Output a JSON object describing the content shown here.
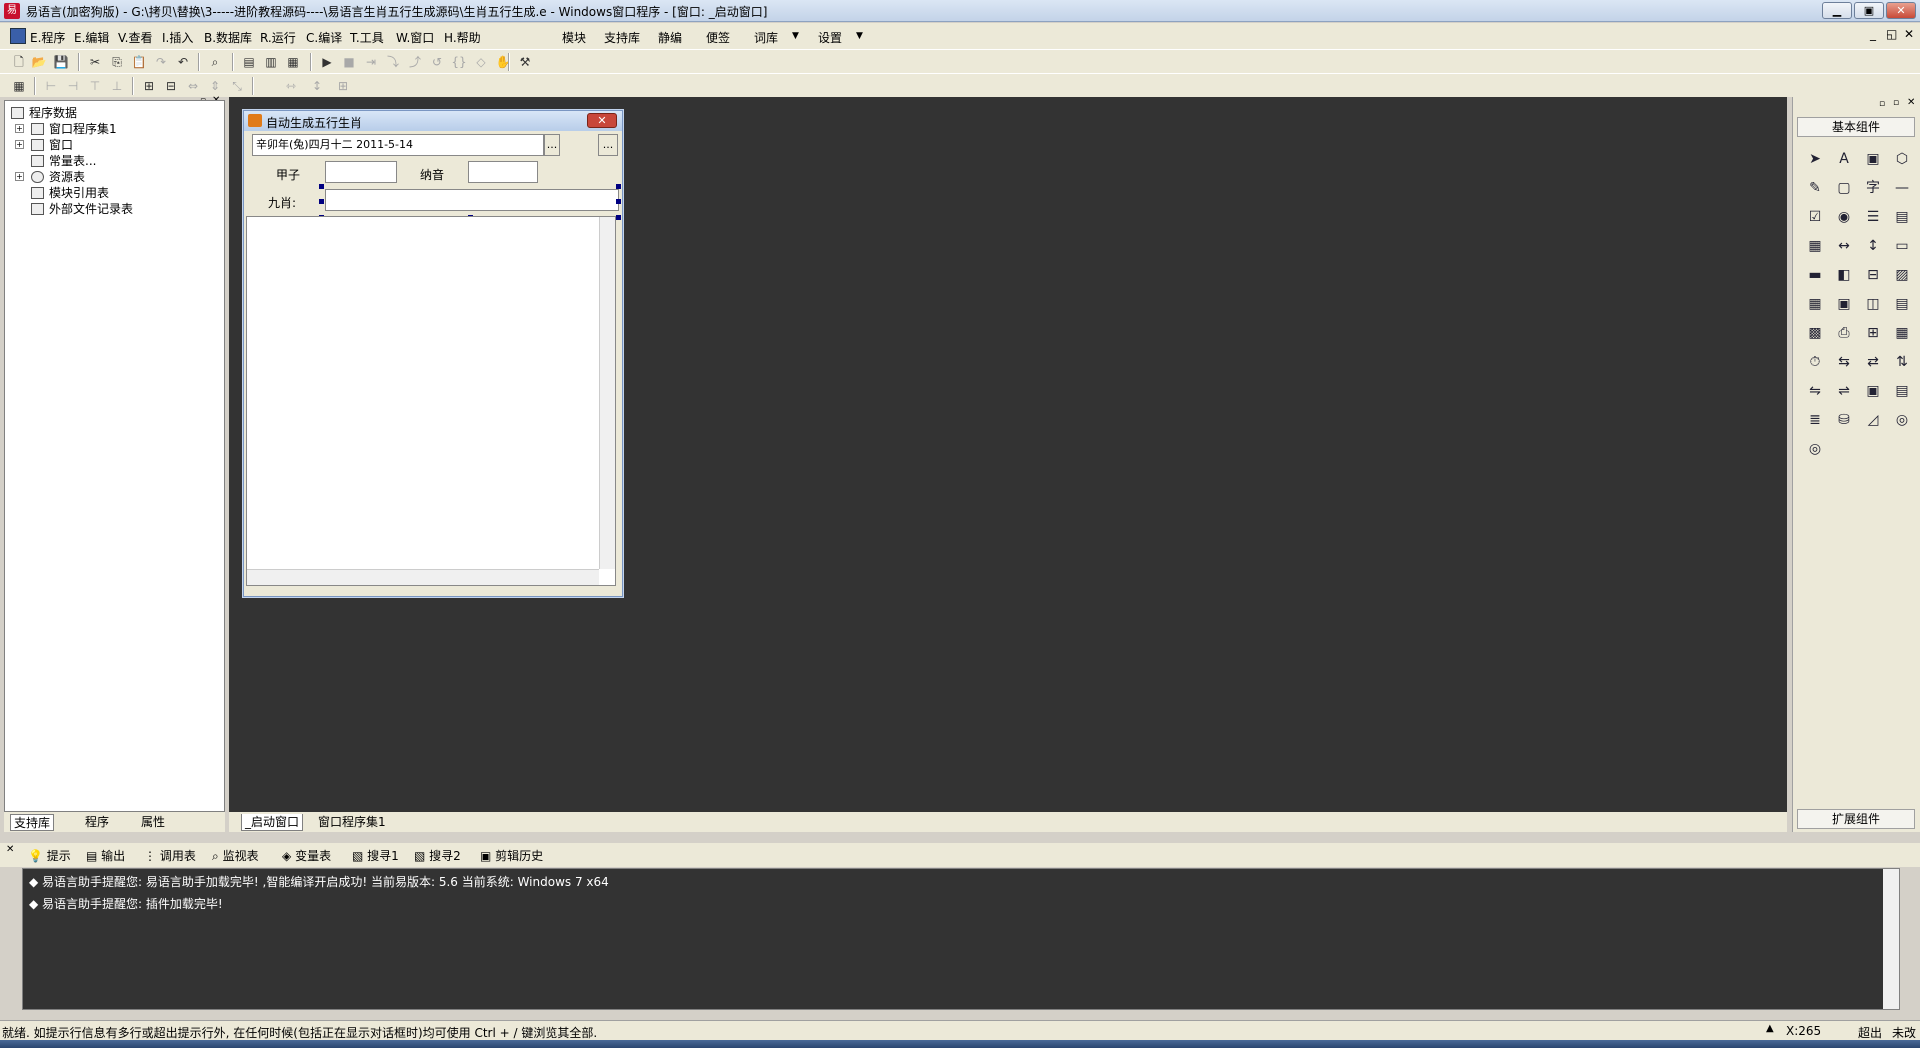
{
  "window": {
    "title": "易语言(加密狗版) - G:\\拷贝\\替换\\3-----进阶教程源码----\\易语言生肖五行生成源码\\生肖五行生成.e - Windows窗口程序 - [窗口: _启动窗口]",
    "app_icon": "易",
    "minimize": "▁",
    "maximize": "▣",
    "close": "✕"
  },
  "menu": {
    "items": [
      "E.程序",
      "E.编辑",
      "V.查看",
      "I.插入",
      "B.数据库",
      "R.运行",
      "C.编译",
      "T.工具",
      "W.窗口",
      "H.帮助"
    ],
    "right_items": [
      "模块",
      "支持库",
      "静编",
      "便签",
      "词库",
      "设置"
    ],
    "mdi_buttons": [
      "_",
      "◱",
      "✕"
    ]
  },
  "tree": {
    "root": "程序数据",
    "items": [
      "窗口程序集1",
      "窗口",
      "常量表...",
      "资源表",
      "模块引用表",
      "外部文件记录表"
    ]
  },
  "left_tabs": [
    "支持库",
    "程序",
    "属性"
  ],
  "design_window": {
    "title": "自动生成五行生肖",
    "date_value": "辛卯年(兔)四月十二 2011-5-14",
    "browse_btn": "...",
    "browse_btn2": "...",
    "label_jiazi": "甲子",
    "label_nayin": "纳音",
    "label_jiuxiao": "九肖:",
    "close": "✕"
  },
  "design_tabs": [
    "_启动窗口",
    "窗口程序集1"
  ],
  "right_panel": {
    "header": "基本组件",
    "footer": "扩展组件",
    "icons": [
      "pointer-icon",
      "label-icon",
      "picture-icon",
      "shape-icon",
      "edit-icon",
      "frame-icon",
      "text-icon",
      "line-icon",
      "checkbox-icon",
      "radio-icon",
      "listbox-icon",
      "combobox-icon",
      "grid-icon",
      "scrollbar-icon",
      "vscroll-icon",
      "hscroll-icon",
      "progress-icon",
      "slider-icon",
      "tab-icon",
      "image-icon",
      "calendar-icon",
      "drive-icon",
      "folder-icon",
      "file-icon",
      "color-icon",
      "printer-icon",
      "tree-icon",
      "table-icon",
      "timer-icon",
      "network-icon",
      "server-icon",
      "client-icon",
      "port-icon",
      "dde-icon",
      "form-icon",
      "list-icon",
      "data-icon",
      "source-icon",
      "chart-icon",
      "odbc-icon",
      "odbc2-icon"
    ]
  },
  "output_tabs": [
    "提示",
    "输出",
    "调用表",
    "监视表",
    "变量表",
    "搜寻1",
    "搜寻2",
    "剪辑历史"
  ],
  "output_lines": [
    "◆ 易语言助手提醒您: 易语言助手加载完毕! ,智能编译开启成功! 当前易版本: 5.6 当前系统: Windows 7 x64",
    "◆ 易语言助手提醒您: 插件加载完毕!"
  ],
  "status": {
    "text": "就绪. 如提示行信息有多行或超出提示行外, 在任何时候(包括正在显示对话框时)均可使用 Ctrl + / 键浏览其全部.",
    "coord": "X:265",
    "mode1": "超出",
    "mode2": "未改"
  }
}
